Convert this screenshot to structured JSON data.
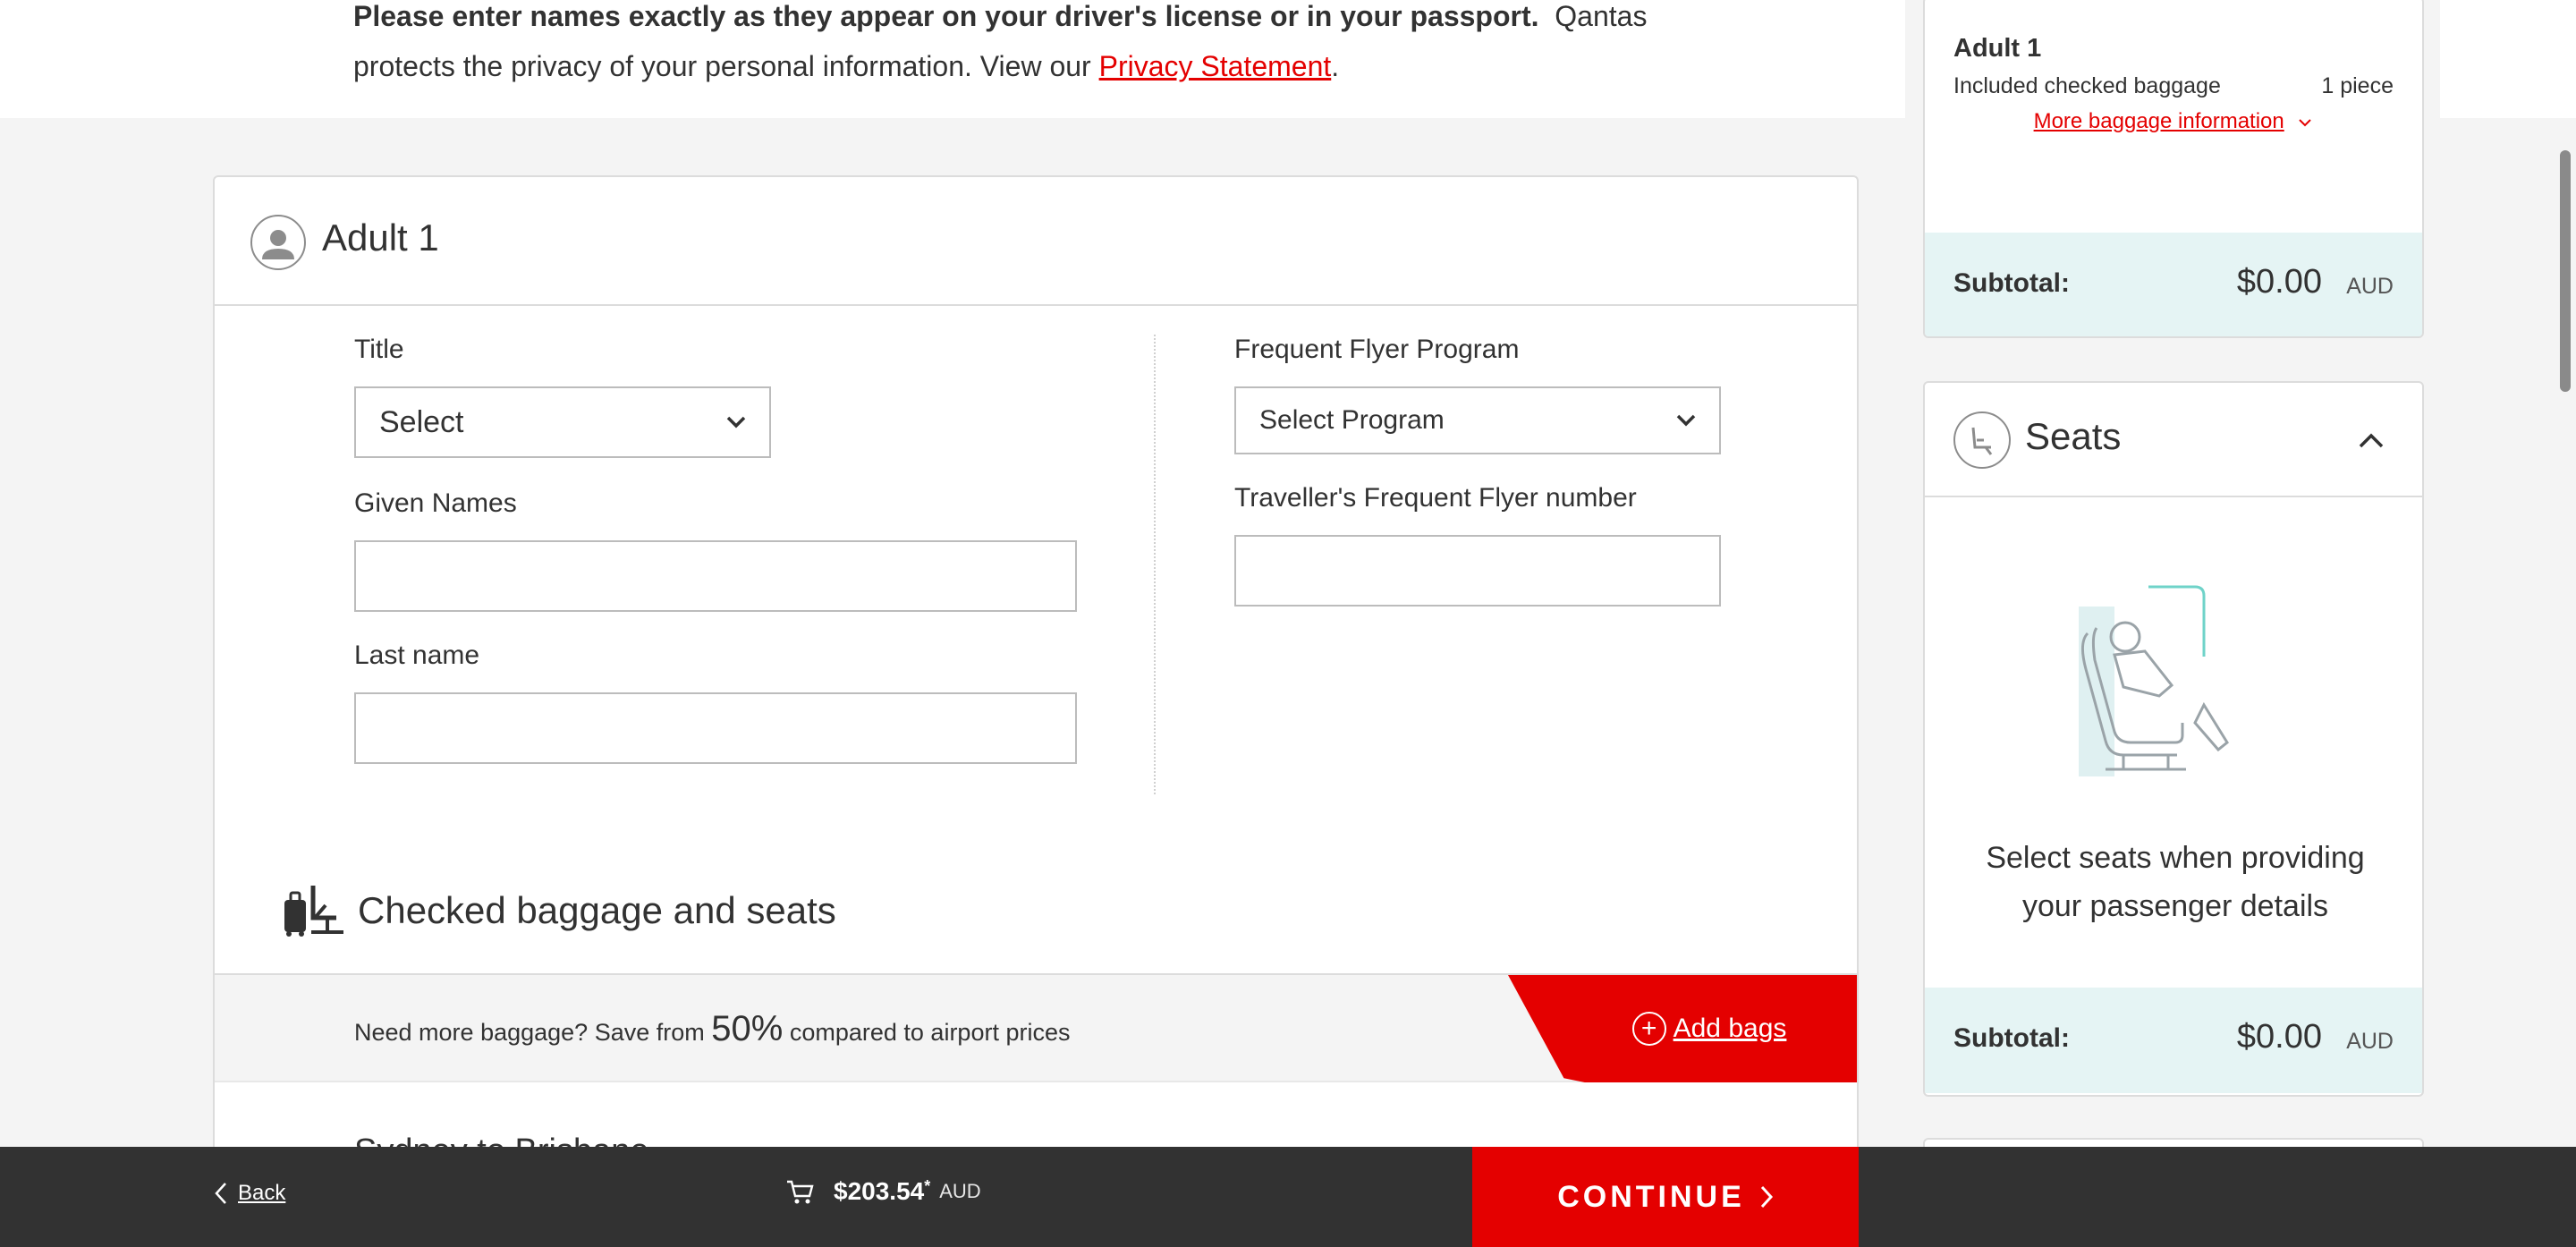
{
  "notice": {
    "bold_text": "Please enter names exactly as they appear on your driver's license or in your passport.",
    "text": "Qantas protects the privacy of your personal information. View our",
    "link": "Privacy Statement",
    "end": "."
  },
  "passenger": {
    "title": "Adult 1",
    "fields": {
      "title_label": "Title",
      "title_value": "Select",
      "given_label": "Given Names",
      "given_value": "",
      "last_label": "Last name",
      "last_value": "",
      "ff_program_label": "Frequent Flyer Program",
      "ff_program_value": "Select Program",
      "ff_number_label": "Traveller's Frequent Flyer number",
      "ff_number_value": ""
    },
    "baggage_heading": "Checked baggage and seats",
    "promo": {
      "prefix": "Need more baggage? Save from",
      "percent": "50%",
      "suffix": "compared to airport prices",
      "button": "Add bags"
    },
    "route": "Sydney to Brisbane"
  },
  "sidebar": {
    "baggage": {
      "passenger": "Adult 1",
      "included_label": "Included checked baggage",
      "included_value": "1 piece",
      "more_link": "More baggage information",
      "subtotal_label": "Subtotal:",
      "subtotal_value": "$0.00",
      "currency": "AUD"
    },
    "seats": {
      "title": "Seats",
      "message": "Select seats when providing your passenger details",
      "subtotal_label": "Subtotal:",
      "subtotal_value": "$0.00",
      "currency": "AUD"
    }
  },
  "footer": {
    "back": "Back",
    "total": "$203.54",
    "asterisk": "*",
    "currency": "AUD",
    "continue": "CONTINUE"
  },
  "colors": {
    "brand_red": "#e40000",
    "subtotal_bg": "#e5f4f4",
    "footer_bg": "#323232"
  }
}
